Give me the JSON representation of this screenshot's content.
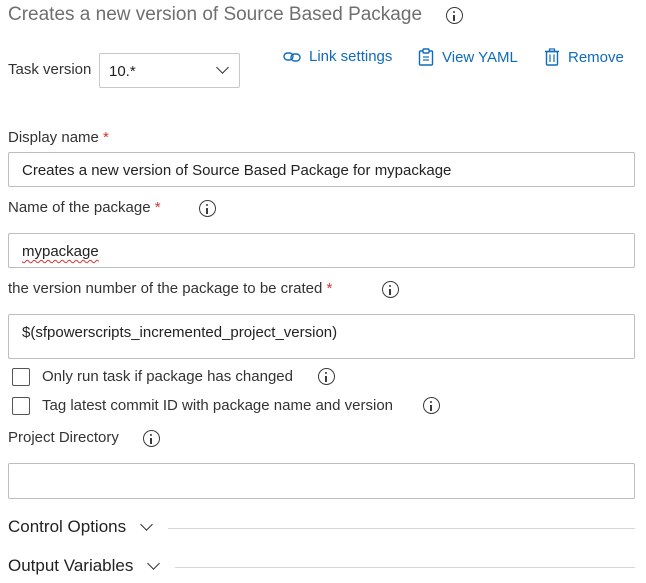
{
  "header": {
    "title": "Creates a new version of Source Based Package"
  },
  "task_version": {
    "label": "Task version",
    "value": "10.*"
  },
  "toolbar": {
    "link_settings": "Link settings",
    "view_yaml": "View YAML",
    "remove": "Remove"
  },
  "fields": {
    "display_name": {
      "label": "Display name",
      "required": "*",
      "value": "Creates a new version of Source Based Package for  mypackage"
    },
    "package_name": {
      "label": "Name of the package",
      "required": "*",
      "value": "mypackage"
    },
    "version_number": {
      "label": "the version number of the package to be crated",
      "required": "*",
      "value": "$(sfpowerscripts_incremented_project_version)"
    },
    "only_run_if_changed": {
      "label": "Only run task if package has changed",
      "checked": false
    },
    "tag_commit": {
      "label": "Tag latest commit ID with package name and version",
      "checked": false
    },
    "project_directory": {
      "label": "Project Directory",
      "value": ""
    }
  },
  "sections": {
    "control_options": "Control Options",
    "output_variables": "Output Variables"
  },
  "colors": {
    "link": "#0f6cbd",
    "required": "#d13438",
    "title": "#6f6f6f"
  }
}
